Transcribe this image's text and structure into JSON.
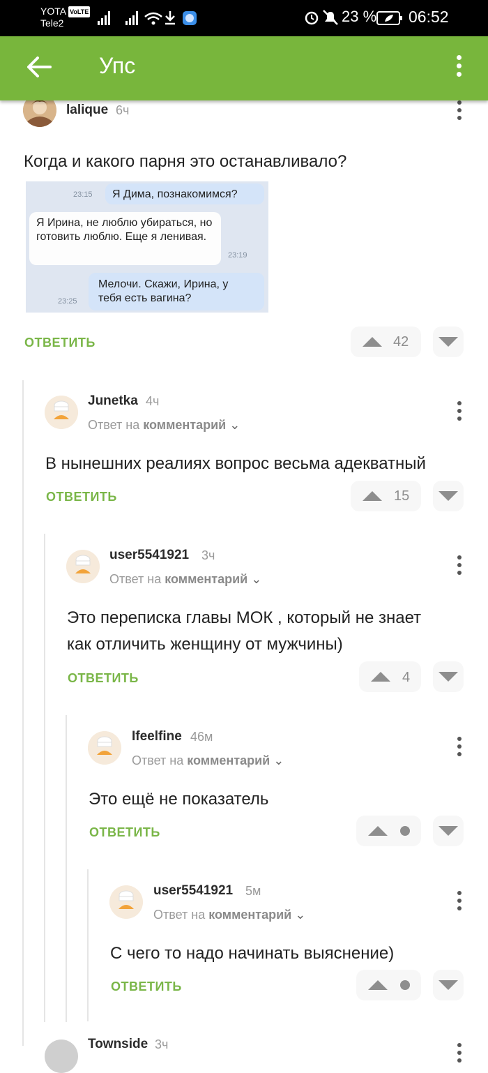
{
  "status": {
    "carrier1": "YOTA",
    "volte": "VoLTE",
    "carrier2": "Tele2",
    "battery": "23 %",
    "time": "06:52"
  },
  "appbar": {
    "title": "Упс"
  },
  "colors": {
    "accent": "#78b63c",
    "answer": "#7ab648",
    "muted": "#9a9a9a"
  },
  "post": {
    "author": "lalique",
    "time": "6ч",
    "text": "Когда и какого парня это останавливало?",
    "answer": "ОТВЕТИТЬ",
    "votes": "42",
    "image": {
      "messages": [
        {
          "time": "23:15",
          "text": "Я Дима, познакомимся?"
        },
        {
          "time": "23:19",
          "text": "Я Ирина, не люблю убираться, но готовить люблю. Еще я ленивая."
        },
        {
          "time": "23:25",
          "text": "Мелочи. Скажи, Ирина, у тебя есть вагина?"
        }
      ]
    }
  },
  "comments": [
    {
      "author": "Junetka",
      "time": "4ч",
      "reply_prefix": "Ответ на",
      "reply_target": "комментарий",
      "text": "В нынешних реалиях вопрос весьма адекватный",
      "answer": "ОТВЕТИТЬ",
      "votes": "15"
    },
    {
      "author": "user5541921",
      "time": "3ч",
      "reply_prefix": "Ответ на",
      "reply_target": "комментарий",
      "text_line1": "Это переписка главы МОК , который не знает",
      "text_line2": "как отличить женщину от мужчины)",
      "answer": "ОТВЕТИТЬ",
      "votes": "4"
    },
    {
      "author": "Ifeelfine",
      "time": "46м",
      "reply_prefix": "Ответ на",
      "reply_target": "комментарий",
      "text": "Это ещё не показатель",
      "answer": "ОТВЕТИТЬ"
    },
    {
      "author": "user5541921",
      "time": "5м",
      "reply_prefix": "Ответ на",
      "reply_target": "комментарий",
      "text": "С чего то надо начинать выяснение)",
      "answer": "ОТВЕТИТЬ"
    },
    {
      "author": "Townside",
      "time": "3ч"
    }
  ]
}
